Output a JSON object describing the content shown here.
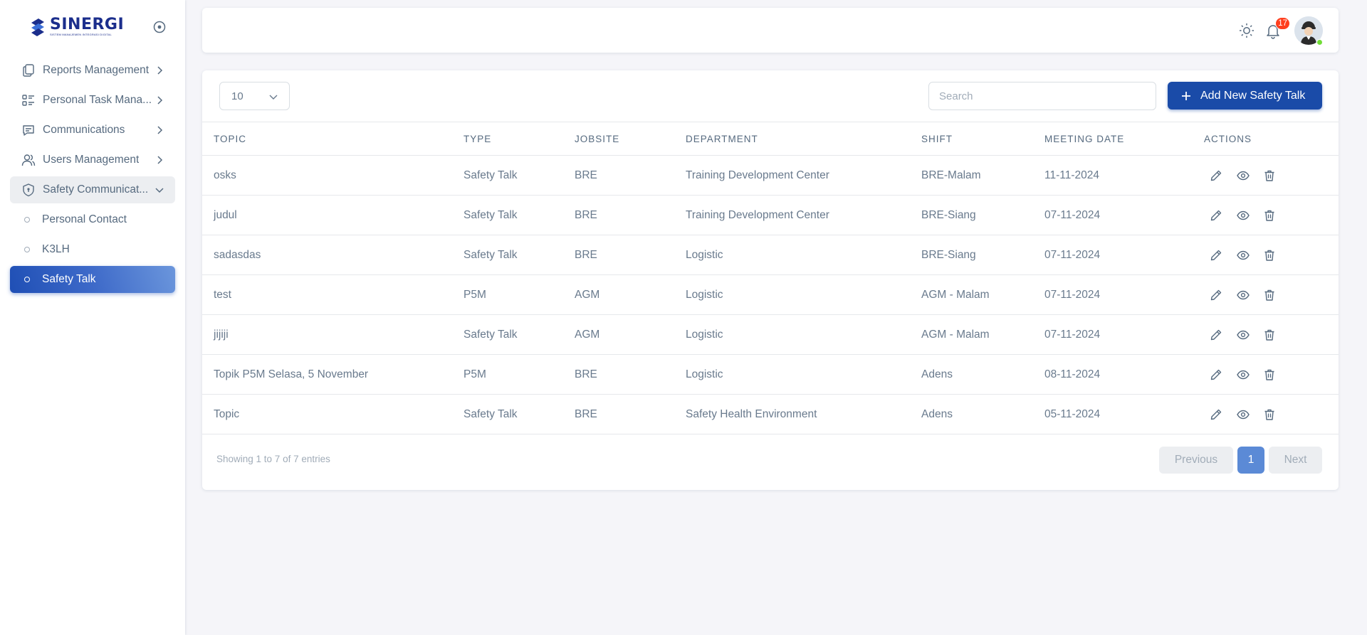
{
  "brand": {
    "name": "SINERGI",
    "tagline": "SISTEM MANAJEMEN INTEGRASI DIGITAL"
  },
  "sidebar": {
    "items": [
      {
        "label": "Reports Management",
        "icon": "files-icon"
      },
      {
        "label": "Personal Task Mana...",
        "icon": "checklist-icon"
      },
      {
        "label": "Communications",
        "icon": "message-icon"
      },
      {
        "label": "Users Management",
        "icon": "users-icon"
      },
      {
        "label": "Safety Communicat...",
        "icon": "shield-icon",
        "open": true
      }
    ],
    "sub_items": [
      {
        "label": "Personal Contact"
      },
      {
        "label": "K3LH"
      },
      {
        "label": "Safety Talk",
        "active": true
      }
    ]
  },
  "navbar": {
    "notification_count": "17"
  },
  "toolbar": {
    "page_length": "10",
    "search_placeholder": "Search",
    "add_label": "Add New Safety Talk"
  },
  "table": {
    "columns": [
      "TOPIC",
      "TYPE",
      "JOBSITE",
      "DEPARTMENT",
      "SHIFT",
      "MEETING DATE",
      "ACTIONS"
    ],
    "rows": [
      {
        "topic": "osks",
        "type": "Safety Talk",
        "jobsite": "BRE",
        "department": "Training Development Center",
        "shift": "BRE-Malam",
        "date": "11-11-2024"
      },
      {
        "topic": "judul",
        "type": "Safety Talk",
        "jobsite": "BRE",
        "department": "Training Development Center",
        "shift": "BRE-Siang",
        "date": "07-11-2024"
      },
      {
        "topic": "sadasdas",
        "type": "Safety Talk",
        "jobsite": "BRE",
        "department": "Logistic",
        "shift": "BRE-Siang",
        "date": "07-11-2024"
      },
      {
        "topic": "test",
        "type": "P5M",
        "jobsite": "AGM",
        "department": "Logistic",
        "shift": "AGM - Malam",
        "date": "07-11-2024"
      },
      {
        "topic": "jijiji",
        "type": "Safety Talk",
        "jobsite": "AGM",
        "department": "Logistic",
        "shift": "AGM - Malam",
        "date": "07-11-2024"
      },
      {
        "topic": "Topik P5M Selasa, 5 November",
        "type": "P5M",
        "jobsite": "BRE",
        "department": "Logistic",
        "shift": "Adens",
        "date": "08-11-2024"
      },
      {
        "topic": "Topic",
        "type": "Safety Talk",
        "jobsite": "BRE",
        "department": "Safety Health Environment",
        "shift": "Adens",
        "date": "05-11-2024"
      }
    ]
  },
  "footer": {
    "info": "Showing 1 to 7 of 7 entries",
    "prev_label": "Previous",
    "page": "1",
    "next_label": "Next"
  },
  "colors": {
    "primary": "#1a4ba8",
    "active_gradient_start": "#1f4fb5",
    "badge": "#ff3e1d",
    "text": "#697a8d"
  }
}
